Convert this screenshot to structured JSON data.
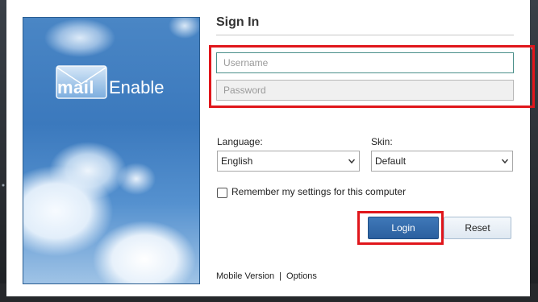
{
  "signin": {
    "title": "Sign In",
    "username_placeholder": "Username",
    "password_placeholder": "Password"
  },
  "logo": {
    "mail": "mail",
    "enable": "Enable"
  },
  "options": {
    "language_label": "Language:",
    "language_value": "English",
    "skin_label": "Skin:",
    "skin_value": "Default",
    "remember_label": "Remember my settings for this computer",
    "remember_checked": false
  },
  "buttons": {
    "login": "Login",
    "reset": "Reset"
  },
  "footer": {
    "mobile": "Mobile Version",
    "separator": "|",
    "options": "Options"
  },
  "colors": {
    "highlight": "#e0161b",
    "login_button": "#2f67a8",
    "brand_sky": "#3b79bd"
  },
  "icons": [
    "envelope-icon",
    "chevron-down-icon"
  ]
}
